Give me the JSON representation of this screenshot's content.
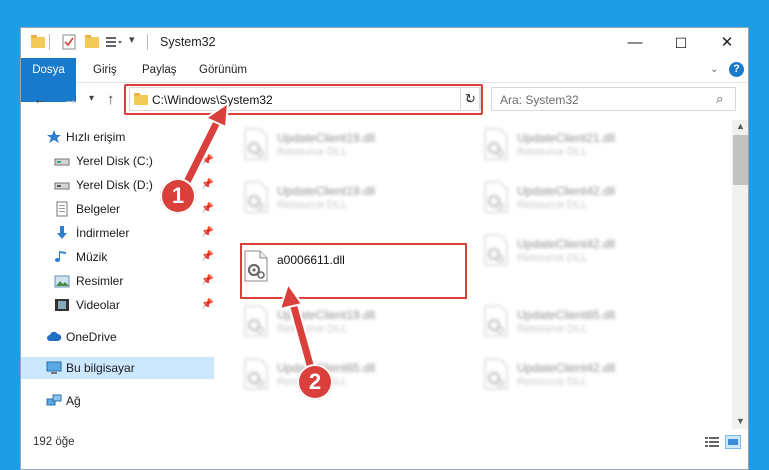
{
  "window": {
    "title": "System32",
    "controls": {
      "minimize": "—",
      "maximize": "☐",
      "close": "✕"
    }
  },
  "ribbon": {
    "tabs": [
      "Dosya",
      "Giriş",
      "Paylaş",
      "Görünüm"
    ],
    "help": "?"
  },
  "address": {
    "path": "C:\\Windows\\System32",
    "search_placeholder": "Ara: System32"
  },
  "sidebar": {
    "items": [
      {
        "label": "Hızlı erişim",
        "icon": "star-icon"
      },
      {
        "label": "Yerel Disk (C:)",
        "icon": "drive-icon"
      },
      {
        "label": "Yerel Disk (D:)",
        "icon": "drive-icon"
      },
      {
        "label": "Belgeler",
        "icon": "document-icon"
      },
      {
        "label": "İndirmeler",
        "icon": "download-icon"
      },
      {
        "label": "Müzik",
        "icon": "music-icon"
      },
      {
        "label": "Resimler",
        "icon": "picture-icon"
      },
      {
        "label": "Videolar",
        "icon": "video-icon"
      },
      {
        "label": "OneDrive",
        "icon": "cloud-icon"
      },
      {
        "label": "Bu bilgisayar",
        "icon": "computer-icon"
      },
      {
        "label": "Ağ",
        "icon": "network-icon"
      }
    ]
  },
  "files": [
    {
      "name": "UpdateClient19.dll",
      "type": "Resource DLL"
    },
    {
      "name": "UpdateClient21.dll",
      "type": "Resource DLL"
    },
    {
      "name": "UpdateClient19.dll",
      "type": "Resource DLL"
    },
    {
      "name": "UpdateClient42.dll",
      "type": "Resource DLL"
    },
    {
      "name": "a0006611.dll",
      "type": ""
    },
    {
      "name": "UpdateClient42.dll",
      "type": "Resource DLL"
    },
    {
      "name": "UpdateClient19.dll",
      "type": "Resource DLL"
    },
    {
      "name": "UpdateClient65.dll",
      "type": "Resource DLL"
    },
    {
      "name": "UpdateClient65.dll",
      "type": "Resource DLL"
    },
    {
      "name": "UpdateClient42.dll",
      "type": "Resource DLL"
    }
  ],
  "status": {
    "count": "192 öğe"
  },
  "callouts": {
    "step1": "1",
    "step2": "2"
  },
  "colors": {
    "highlight": "#d9403b",
    "accent": "#1979ca",
    "desktop": "#1e9de6"
  }
}
